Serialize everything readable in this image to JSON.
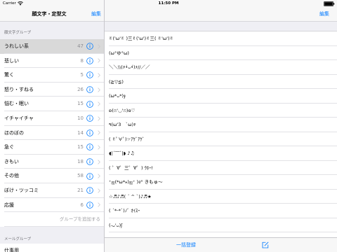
{
  "status_bar": {
    "carrier": "Carrier",
    "time": "11:50 PM",
    "battery_level": 1.0,
    "icons": [
      "wifi-icon",
      "battery-icon"
    ]
  },
  "sidebar": {
    "title": "顔文字・定型文",
    "edit_label": "編集",
    "emoticon_section_header": "顔文字グループ",
    "selected_index": 0,
    "groups": [
      {
        "name": "うれしい系",
        "count": 47
      },
      {
        "name": "悲しい",
        "count": 8
      },
      {
        "name": "驚く",
        "count": 5
      },
      {
        "name": "怒り・すねる",
        "count": 26
      },
      {
        "name": "悩む・眠い",
        "count": 15
      },
      {
        "name": "イチャイチャ",
        "count": 10
      },
      {
        "name": "ほのぼの",
        "count": 14
      },
      {
        "name": "急ぐ",
        "count": 15
      },
      {
        "name": "きもい",
        "count": 18
      },
      {
        "name": "その他",
        "count": 58
      },
      {
        "name": "ぼけ・ツッコミ",
        "count": 21
      },
      {
        "name": "応援",
        "count": 6
      }
    ],
    "add_group_label": "グループを追加する",
    "mail_section_header": "メールグループ",
    "mail_groups": [
      {
        "name": "仕事用"
      }
    ],
    "row_icons": [
      "info-icon",
      "chevron-right-icon"
    ]
  },
  "detail": {
    "edit_label": "編集",
    "emoticons": [
      "✌('ω'✌ )三✌('ω')✌三( ✌'ω')✌",
      "(ω°ゆ°ω)",
      "＼＼\\\\(۶•̀ᴗ•́)۶//／／",
      "(≧▽≦)",
      "(ω*ᴗ*)ჯ",
      "ʚ(ෆ'◡'ෆ)ɞ♡",
      "٩(ω'3　`ω)۶",
      "( ✌ﾟ∀ﾟ)☞ｱｹﾞｱｹﾞ",
      "◖|´‾‾`|◗ ♪♫",
      "( ゜∀゜三゜∀゜) ｳﾎｰ!",
      "⁺ஐ(*ω*⁎)ஐ⁺ )ง° きもゅ～",
      "☆♬♪♬( ´ ^ `)♪♬★",
      "( ´*ᵕ*`)ﾉﾞ ｵｲｽｰ",
      "(-ᴗ'ᴗ)ʃ"
    ],
    "toolbar": {
      "bulk_register_label": "一括登録",
      "compose_icon": "compose-icon"
    }
  },
  "colors": {
    "accent": "#007aff",
    "selected_row": "#d9d9d9",
    "secondary_text": "#8e8e93",
    "grouped_background": "#efeff4"
  }
}
